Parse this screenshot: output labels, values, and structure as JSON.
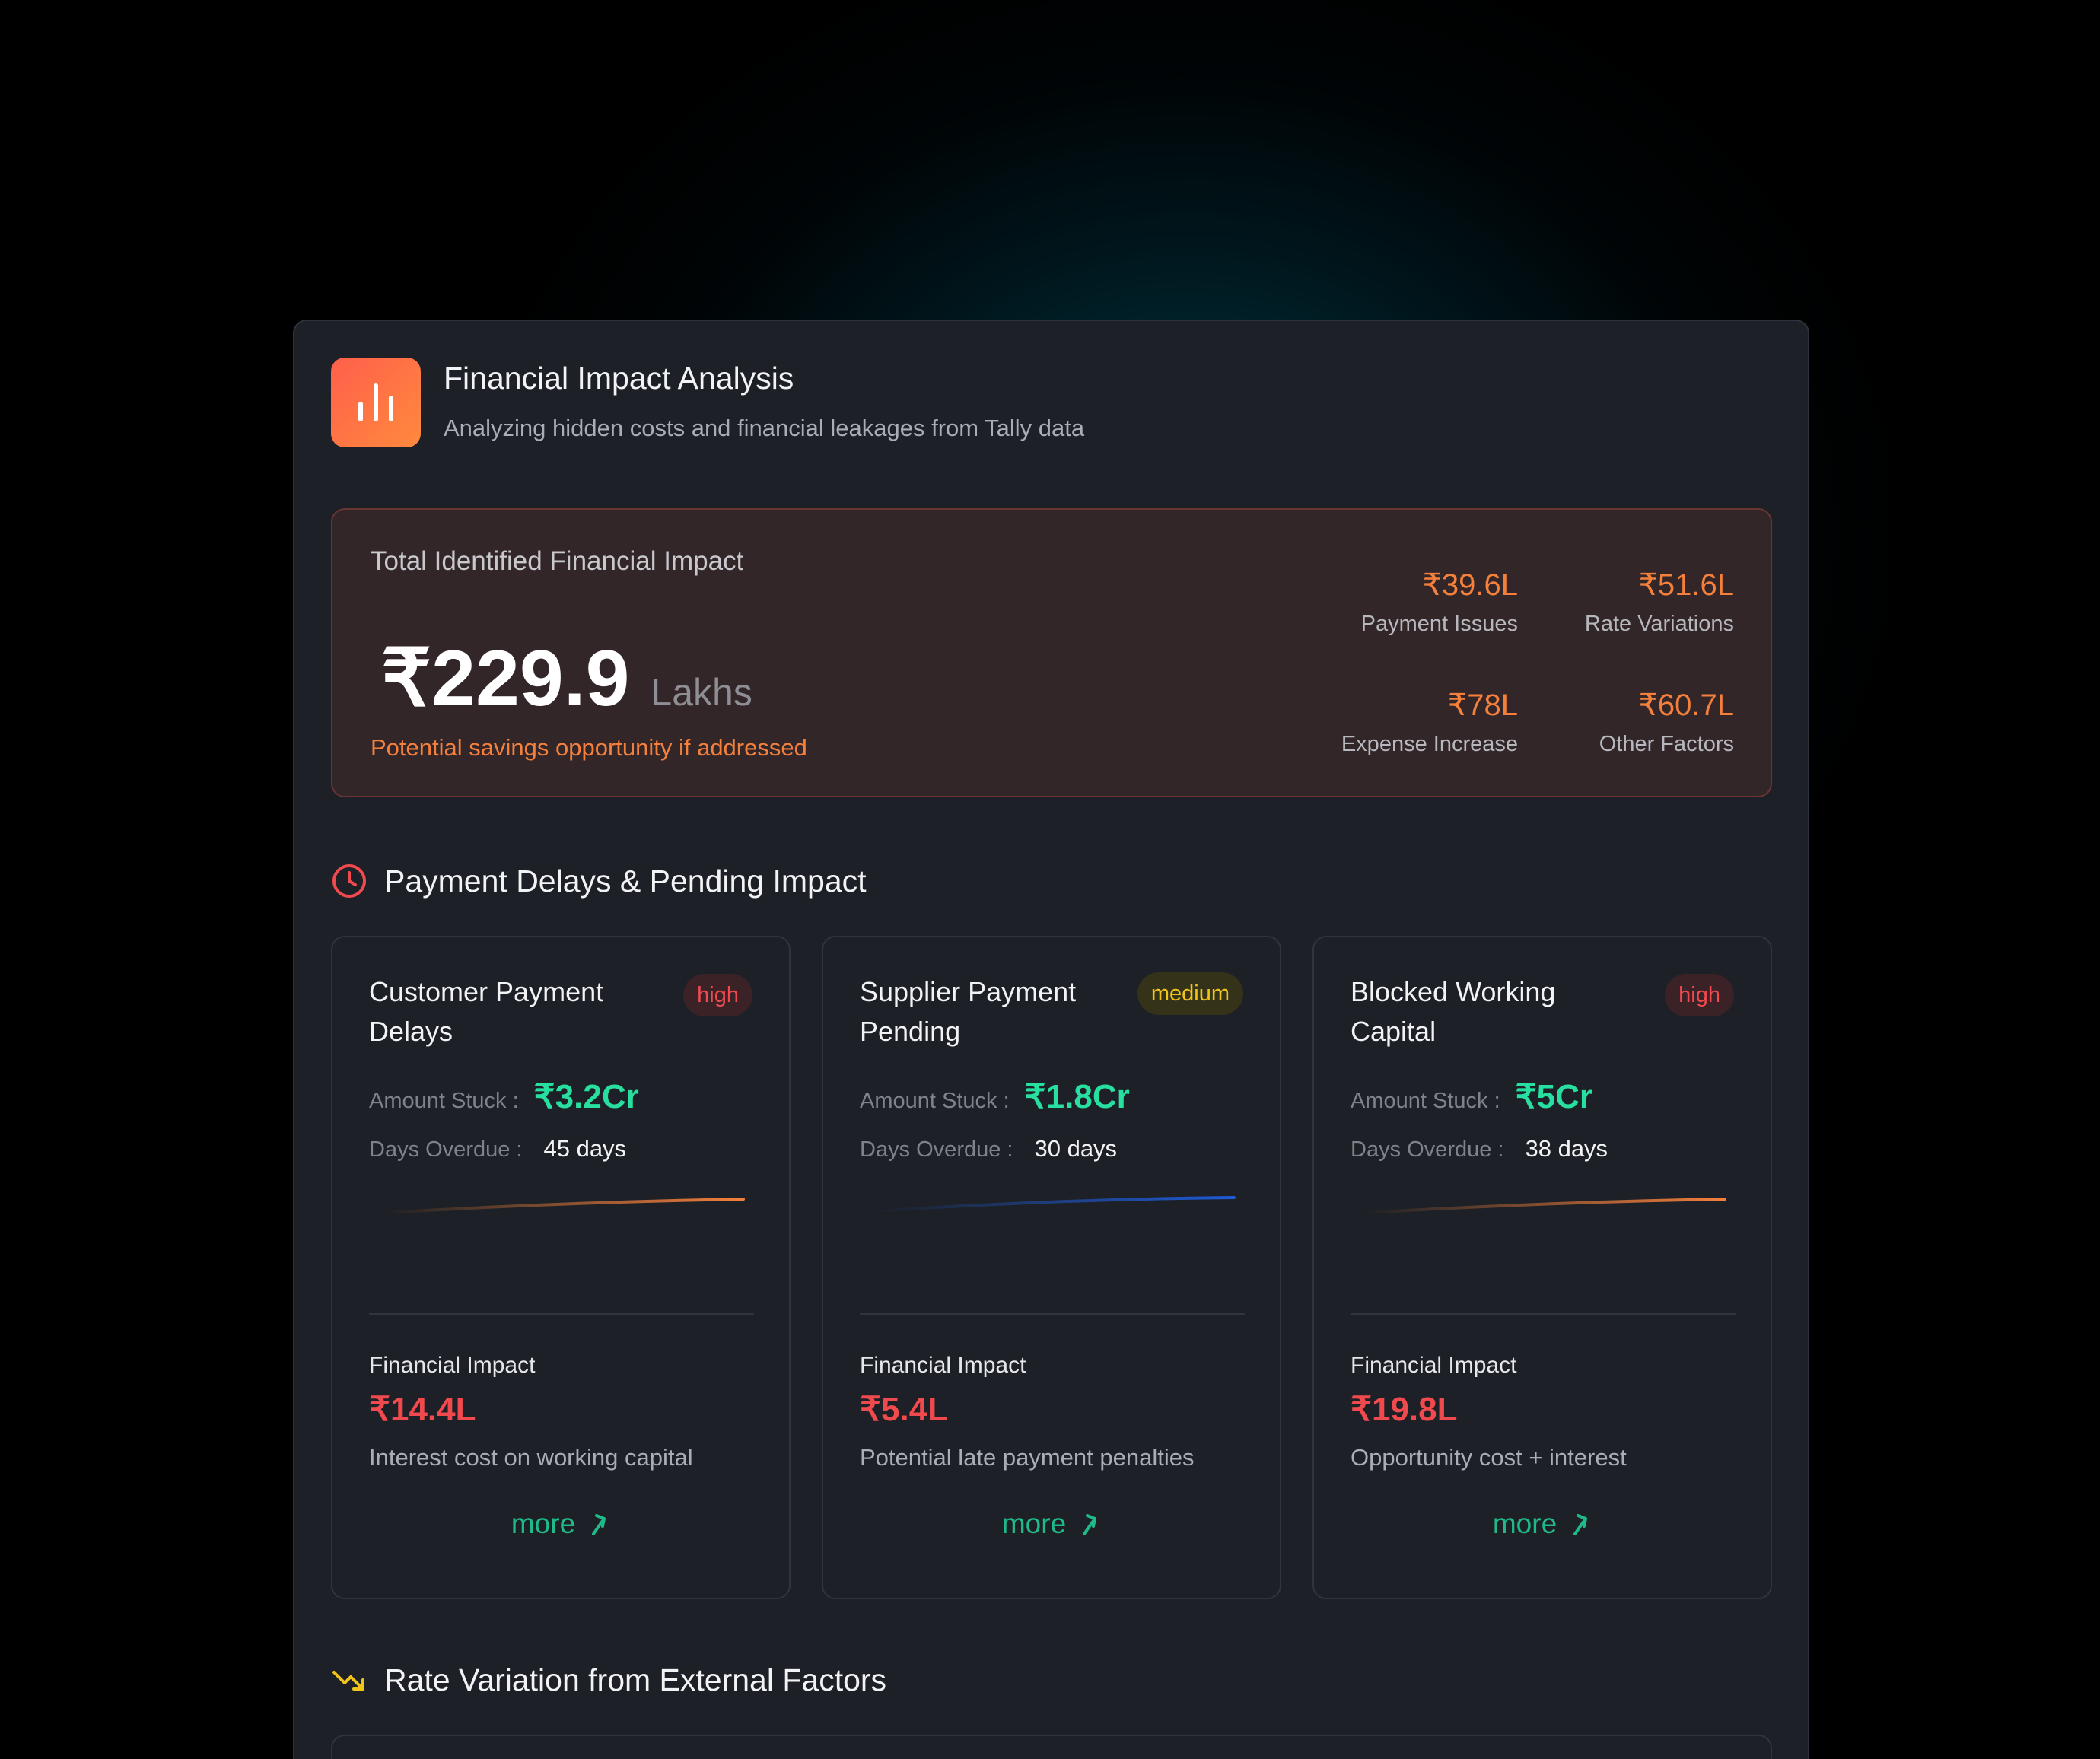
{
  "header": {
    "title": "Financial Impact Analysis",
    "subtitle": "Analyzing hidden costs and financial leakages from Tally data",
    "icon": "bar-chart-icon"
  },
  "summary": {
    "label": "Total Identified Financial Impact",
    "value": "₹229.9",
    "unit": "Lakhs",
    "note": "Potential savings opportunity if addressed",
    "stats": [
      {
        "value": "₹39.6L",
        "label": "Payment Issues"
      },
      {
        "value": "₹51.6L",
        "label": "Rate Variations"
      },
      {
        "value": "₹78L",
        "label": "Expense Increase"
      },
      {
        "value": "₹60.7L",
        "label": "Other Factors"
      }
    ]
  },
  "section_payment": {
    "title": "Payment Delays & Pending Impact",
    "icon": "clock-icon"
  },
  "cards": [
    {
      "title": "Customer Payment Delays",
      "badge": "high",
      "amount_label": "Amount Stuck :",
      "amount": "₹3.2Cr",
      "days_label": "Days Overdue :",
      "days": "45 days",
      "trend_color": "#f4803c",
      "fi_label": "Financial Impact",
      "fi_value": "₹14.4L",
      "fi_desc": "Interest cost on working capital",
      "more": "more"
    },
    {
      "title": "Supplier Payment Pending",
      "badge": "medium",
      "amount_label": "Amount Stuck :",
      "amount": "₹1.8Cr",
      "days_label": "Days Overdue :",
      "days": "30  days",
      "trend_color": "#1e5bd8",
      "fi_label": "Financial Impact",
      "fi_value": "₹5.4L",
      "fi_desc": "Potential late payment penalties",
      "more": "more"
    },
    {
      "title": "Blocked Working Capital",
      "badge": "high",
      "amount_label": "Amount Stuck :",
      "amount": "₹5Cr",
      "days_label": "Days Overdue :",
      "days": "38 days",
      "trend_color": "#f4803c",
      "fi_label": "Financial Impact",
      "fi_value": "₹19.8L",
      "fi_desc": "Opportunity cost + interest",
      "more": "more"
    }
  ],
  "section_rate": {
    "title": "Rate Variation from External Factors",
    "icon": "trending-down-icon"
  },
  "colors": {
    "accent_orange": "#f4803c",
    "accent_green": "#27e0a0",
    "accent_red": "#f04a4f",
    "accent_yellow": "#f0c419"
  }
}
